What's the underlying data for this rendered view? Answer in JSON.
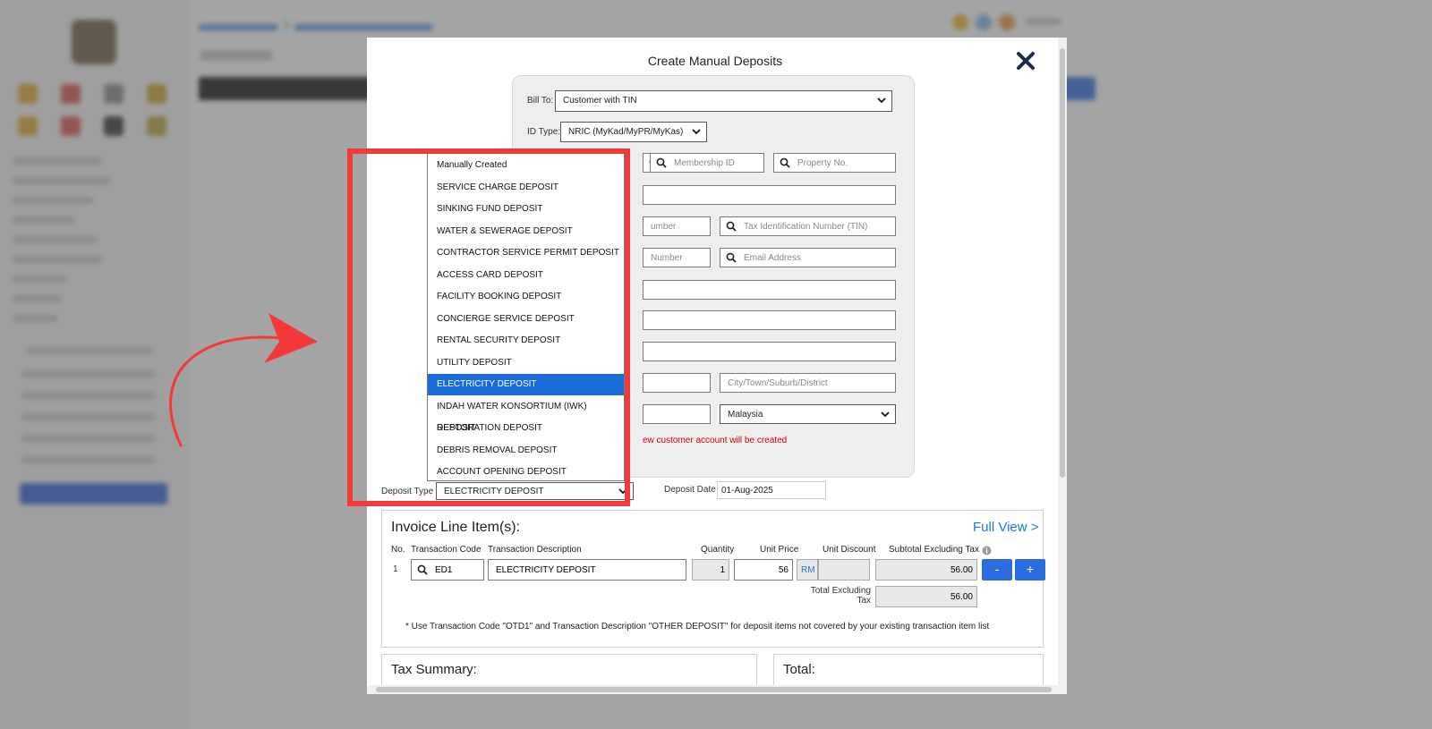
{
  "modal": {
    "title": "Create Manual Deposits",
    "bill_to_label": "Bill To:",
    "bill_to_value": "Customer with TIN",
    "id_type_label": "ID Type:",
    "id_type_value": "NRIC (MyKad/MyPR/MyKas)",
    "membership_id_placeholder": "Membership ID",
    "property_no_placeholder": "Property No.",
    "phone_partial_placeholder": "umber",
    "tin_placeholder": "Tax Identification Number (TIN)",
    "mobile_partial_placeholder": "Number",
    "email_placeholder": "Email Address",
    "city_placeholder": "City/Town/Suburb/District",
    "country_value": "Malaysia",
    "new_account_note": "ew customer account will be created",
    "deposit_type_label": "Deposit Type",
    "deposit_type_value": "ELECTRICITY DEPOSIT",
    "deposit_date_label": "Deposit Date",
    "deposit_date_value": "01-Aug-2025"
  },
  "deposit_type_options": [
    "Manually Created",
    "SERVICE CHARGE DEPOSIT",
    "SINKING FUND DEPOSIT",
    "WATER & SEWERAGE DEPOSIT",
    "CONTRACTOR SERVICE PERMIT DEPOSIT",
    "ACCESS CARD DEPOSIT",
    "FACILITY BOOKING DEPOSIT",
    "CONCIERGE SERVICE DEPOSIT",
    "RENTAL SECURITY DEPOSIT",
    "UTILITY DEPOSIT",
    "ELECTRICITY DEPOSIT",
    "INDAH WATER KONSORTIUM (IWK) DEPOSIT",
    "RESTORATION DEPOSIT",
    "DEBRIS REMOVAL DEPOSIT",
    "ACCOUNT OPENING DEPOSIT"
  ],
  "selected_option_index": 10,
  "invoice": {
    "title": "Invoice Line Item(s):",
    "full_view": "Full View >",
    "headers": {
      "no": "No.",
      "code": "Transaction Code",
      "desc": "Transaction Description",
      "qty": "Quantity",
      "unit_price": "Unit Price",
      "unit_discount": "Unit Discount",
      "subtotal": "Subtotal Excluding Tax"
    },
    "row": {
      "no": "1",
      "code": "ED1",
      "desc": "ELECTRICITY DEPOSIT",
      "qty": "1",
      "unit_price": "56",
      "currency": "RM",
      "unit_discount": "",
      "subtotal": "56.00"
    },
    "minus": "-",
    "plus": "+",
    "total_excl_label_1": "Total Excluding",
    "total_excl_label_2": "Tax",
    "total_excl_value": "56.00",
    "note": "* Use Transaction Code \"OTD1\" and Transaction Description \"OTHER DEPOSIT\" for deposit items not covered by your existing transaction item list"
  },
  "tax_summary_title": "Tax Summary:",
  "total_title": "Total:",
  "colors": {
    "highlight": "#1a6dd8",
    "annotation_red": "#f23a3a",
    "link_blue": "#1a73e8",
    "button_blue": "#2b6de0"
  }
}
